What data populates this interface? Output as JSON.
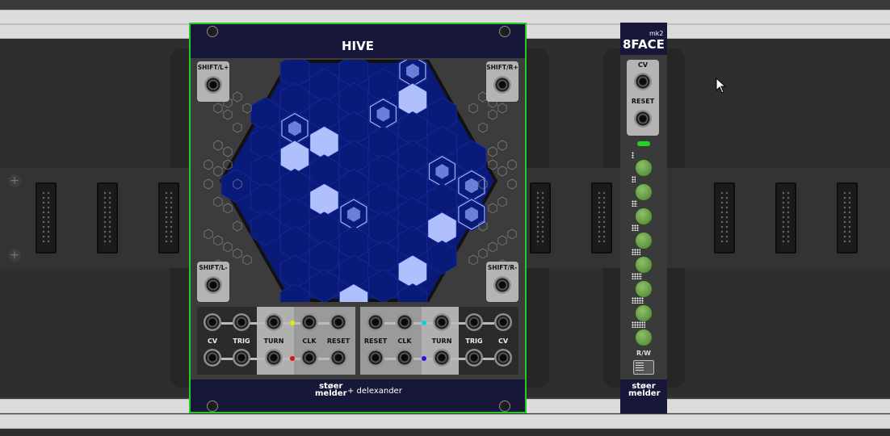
{
  "hive": {
    "title": "HIVE",
    "shift_labels": [
      "SHIFT/L+",
      "SHIFT/R+",
      "SHIFT/L-",
      "SHIFT/R-"
    ],
    "left_labels": [
      "CV",
      "TRIG",
      "TURN",
      "CLK",
      "RESET"
    ],
    "right_labels": [
      "RESET",
      "CLK",
      "TURN",
      "TRIG",
      "CV"
    ],
    "brand_line1": "støer",
    "brand_line2": "melder",
    "brand_suffix": "+ delexander"
  },
  "eightface": {
    "title": "8FACE",
    "subtitle": "mk2",
    "labels": [
      "CV",
      "RESET",
      "R/W"
    ],
    "brand_line1": "støer",
    "brand_line2": "melder",
    "led_color": "#22d422"
  },
  "colors": {
    "dot_yellow": "#e8e800",
    "dot_red": "#e01010",
    "dot_cyan": "#10d0e0",
    "dot_blue": "#3010e0",
    "hex_dark": "#0a1a78",
    "hex_light": "#b0c0ff",
    "hex_mid": "#6c7ed8"
  }
}
